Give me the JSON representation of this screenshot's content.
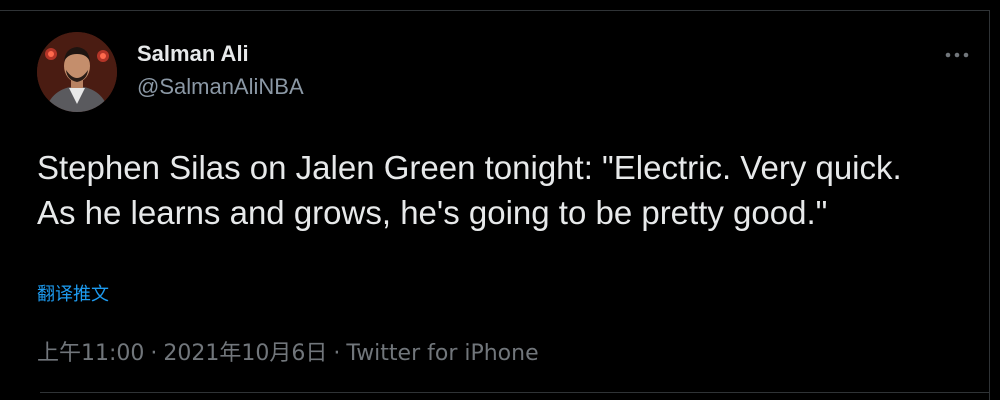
{
  "tweet": {
    "author_name": "Salman Ali",
    "author_handle": "@SalmanAliNBA",
    "text": "Stephen Silas on Jalen Green tonight: \"Electric. Very quick. As he learns and grows, he's going to be pretty good.\"",
    "translate_label": "翻译推文",
    "time": "上午11:00",
    "date": "2021年10月6日",
    "separator": "·",
    "source": "Twitter for iPhone"
  },
  "icons": {
    "more": "more-horizontal-icon",
    "avatar": "profile-avatar"
  },
  "colors": {
    "background": "#000000",
    "text_primary": "#e7e9ea",
    "text_secondary": "#71767b",
    "link": "#1d9bf0"
  }
}
